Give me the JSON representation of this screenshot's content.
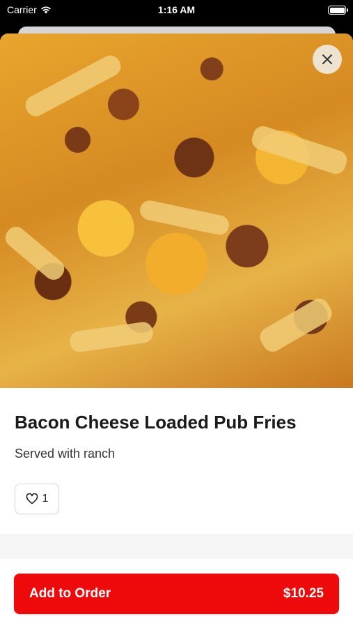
{
  "status_bar": {
    "carrier": "Carrier",
    "time": "1:16 AM",
    "wifi_icon": "wifi-icon",
    "battery_icon": "battery-icon"
  },
  "item": {
    "image_icon": "food-photo",
    "name": "Bacon Cheese Loaded Pub Fries",
    "description": "Served with ranch",
    "likes": "1",
    "like_icon": "heart-icon"
  },
  "close_icon": "close-icon",
  "footer": {
    "add_label": "Add to Order",
    "price": "$10.25"
  },
  "colors": {
    "accent": "#ee0a0a",
    "background": "#ffffff"
  }
}
